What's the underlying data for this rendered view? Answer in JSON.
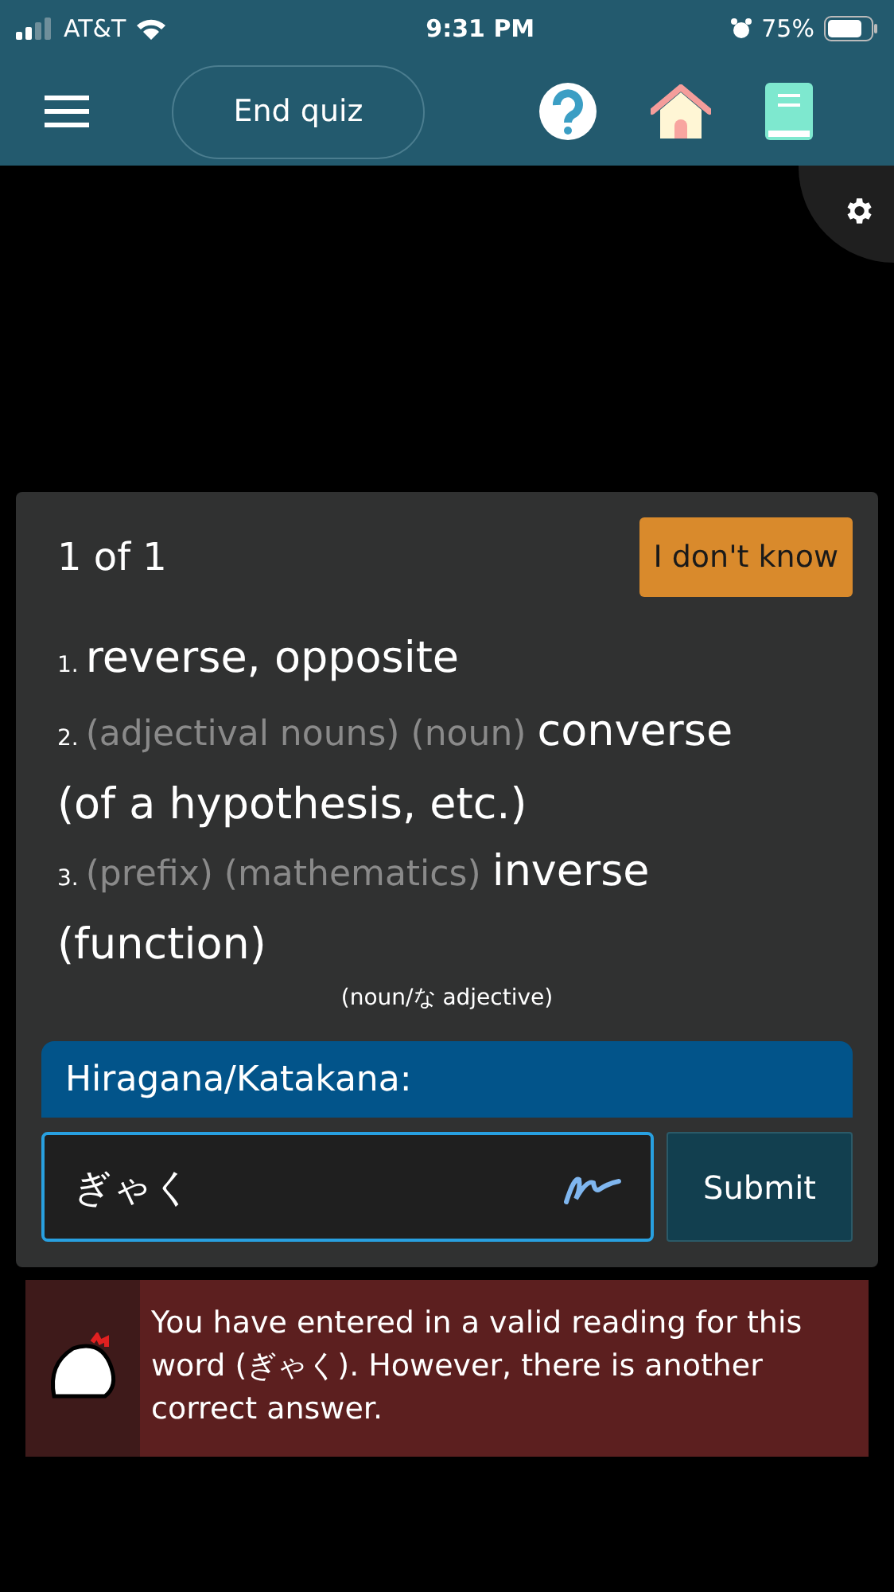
{
  "status_bar": {
    "carrier": "AT&T",
    "time": "9:31 PM",
    "battery": "75%"
  },
  "header": {
    "end_quiz": "End quiz"
  },
  "quiz": {
    "progress": "1 of 1",
    "dont_know": "I don't know",
    "definitions": [
      {
        "number": "1.",
        "gloss": "reverse, opposite"
      },
      {
        "number": "2.",
        "tags": [
          "(adjectival nouns)",
          "(noun)"
        ],
        "gloss": "converse (of a hypothesis, etc.)"
      },
      {
        "number": "3.",
        "tags": [
          "(prefix)",
          "(mathematics)"
        ],
        "gloss": "inverse (function)"
      }
    ],
    "part_of_speech": "(noun/な adjective)",
    "answer_label": "Hiragana/Katakana:",
    "answer_value": "ぎゃく",
    "submit": "Submit"
  },
  "feedback": {
    "message": "You have entered in a valid reading for this word (ぎゃく). However, there is another correct answer."
  }
}
